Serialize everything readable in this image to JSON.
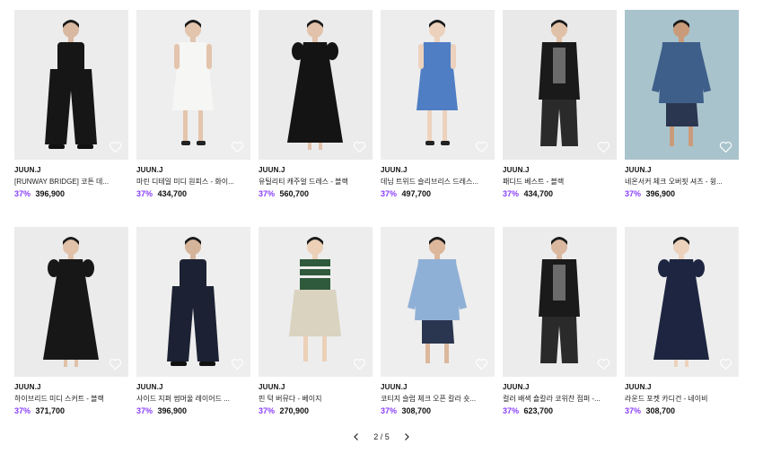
{
  "products": [
    [
      {
        "brand": "JUUN.J",
        "title": "[RUNWAY BRIDGE] 코튼 데...",
        "discount": "37%",
        "price": "396,900",
        "bg": "#ececec",
        "garment": "#161616",
        "skin": "#d8b8a0",
        "kind": "pants"
      },
      {
        "brand": "JUUN.J",
        "title": "마린 디테일 미디 원피스 - 화이...",
        "discount": "37%",
        "price": "434,700",
        "bg": "#eeeeee",
        "garment": "#f6f6f4",
        "skin": "#e3c4ac",
        "kind": "dress-short"
      },
      {
        "brand": "JUUN.J",
        "title": "유틸리티 캐주얼 드레스 - 블랙",
        "discount": "37%",
        "price": "560,700",
        "bg": "#ebebeb",
        "garment": "#141414",
        "skin": "#e2c2aa",
        "kind": "dress-long"
      },
      {
        "brand": "JUUN.J",
        "title": "데님 트위드 슬리브리스 드레스...",
        "discount": "37%",
        "price": "497,700",
        "bg": "#ededed",
        "garment": "#4f7ec4",
        "skin": "#ecd2bd",
        "kind": "dress-short"
      },
      {
        "brand": "JUUN.J",
        "title": "패디드 베스트 - 블랙",
        "discount": "37%",
        "price": "434,700",
        "bg": "#e9e9e9",
        "garment": "#1a1a1a",
        "skin": "#e0c0a6",
        "kind": "vest"
      },
      {
        "brand": "JUUN.J",
        "title": "네온서커 체크 오버핏 셔츠 - 윙...",
        "discount": "37%",
        "price": "396,900",
        "bg": "#a9c3cc",
        "garment": "#3e5f8a",
        "skin": "#c99b7a",
        "kind": "shirt"
      }
    ],
    [
      {
        "brand": "JUUN.J",
        "title": "하이브리드 미디 스커트 - 블랙",
        "discount": "37%",
        "price": "371,700",
        "bg": "#ebebeb",
        "garment": "#171717",
        "skin": "#e1c1a8",
        "kind": "dress-long"
      },
      {
        "brand": "JUUN.J",
        "title": "사이드 지퍼 썸머울 레이어드 ...",
        "discount": "37%",
        "price": "396,900",
        "bg": "#eeeeee",
        "garment": "#1c2233",
        "skin": "#d6b49a",
        "kind": "pants"
      },
      {
        "brand": "JUUN.J",
        "title": "핀 턱 버뮤다 - 베이지",
        "discount": "37%",
        "price": "270,900",
        "bg": "#ededed",
        "garment": "#d9d3bf",
        "skin": "#ecd0b8",
        "kind": "shorts"
      },
      {
        "brand": "JUUN.J",
        "title": "코티지 슬럽 체크 오픈 칼라 숏...",
        "discount": "37%",
        "price": "308,700",
        "bg": "#eeeeee",
        "garment": "#8fb0d6",
        "skin": "#dcb79c",
        "kind": "shirt"
      },
      {
        "brand": "JUUN.J",
        "title": "컬러 배색 숄칼라 코위찬 점퍼 -...",
        "discount": "37%",
        "price": "623,700",
        "bg": "#ececec",
        "garment": "#1a1a1a",
        "skin": "#d9b89f",
        "kind": "vest"
      },
      {
        "brand": "JUUN.J",
        "title": "라운드 포켓 카디건 - 네이비",
        "discount": "37%",
        "price": "308,700",
        "bg": "#ededed",
        "garment": "#1d2540",
        "skin": "#ecd2bd",
        "kind": "dress-long"
      }
    ]
  ],
  "pagination": {
    "current": "2",
    "separator": "/",
    "total": "5"
  },
  "colors": {
    "discount": "#8a3ffc"
  },
  "icons": {
    "wishlist": "heart-outline-icon",
    "prev": "chevron-left-icon",
    "next": "chevron-right-icon"
  }
}
